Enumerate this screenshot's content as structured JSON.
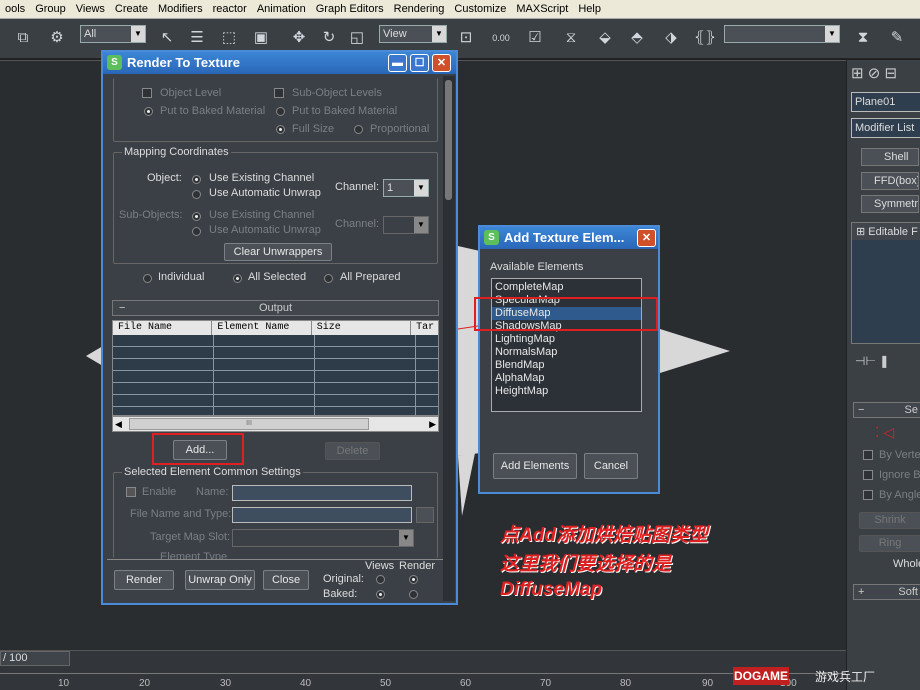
{
  "menubar": {
    "items": [
      "ools",
      "Group",
      "Views",
      "Create",
      "Modifiers",
      "reactor",
      "Animation",
      "Graph Editors",
      "Rendering",
      "Customize",
      "MAXScript",
      "Help"
    ]
  },
  "toolbar": {
    "selection_filter": "All",
    "reference_coord": "View",
    "numeric": "0.00"
  },
  "render_dialog": {
    "title": "Render To Texture",
    "object_level": "Object Level",
    "sub_object_levels": "Sub-Object Levels",
    "put_baked_material": "Put to Baked Material",
    "put_baked_material2": "Put to Baked Material",
    "full_size": "Full Size",
    "proportional": "Proportional",
    "mapping_coordinates": "Mapping Coordinates",
    "object_label": "Object:",
    "use_existing_channel": "Use Existing Channel",
    "use_automatic_unwrap": "Use Automatic Unwrap",
    "channel_label": "Channel:",
    "channel_value": "1",
    "sub_objects_label": "Sub-Objects:",
    "sub_use_existing": "Use Existing Channel",
    "sub_use_automatic": "Use Automatic Unwrap",
    "sub_channel_label": "Channel:",
    "clear_unwrappers": "Clear Unwrappers",
    "individual": "Individual",
    "all_selected": "All Selected",
    "all_prepared": "All Prepared",
    "output_header": "Output",
    "collapse": "−",
    "columns": [
      "File Name",
      "Element Name",
      "Size",
      "Tar"
    ],
    "scroll_grip": "III",
    "add_button": "Add...",
    "delete_button": "Delete",
    "selected_common": "Selected Element Common Settings",
    "enable": "Enable",
    "name_label": "Name:",
    "file_name_type": "File Name and Type:",
    "target_map_slot": "Target Map Slot:",
    "element_type": "Element Type",
    "render_button": "Render",
    "unwrap_only_button": "Unwrap Only",
    "close_button": "Close",
    "views": "Views",
    "render_col": "Render",
    "original": "Original:",
    "baked": "Baked:"
  },
  "add_dialog": {
    "title": "Add Texture Elem...",
    "available_elements": "Available Elements",
    "items": [
      "CompleteMap",
      "SpecularMap",
      "DiffuseMap",
      "ShadowsMap",
      "LightingMap",
      "NormalsMap",
      "BlendMap",
      "AlphaMap",
      "HeightMap"
    ],
    "selected_index": 2,
    "add_elements_button": "Add Elements",
    "cancel_button": "Cancel"
  },
  "annotation": {
    "line1": "点Add添加烘焙贴图类型",
    "line2": "这里我们要选择的是",
    "line3": "DiffuseMap"
  },
  "right_panel": {
    "object_name": "Plane01",
    "modifier_list": "Modifier List",
    "buttons": [
      "Shell",
      "FFD(box)",
      "Symmetry"
    ],
    "stack_item": "Editable F",
    "sel_rollout": "Se",
    "by_vertex": "By Verte",
    "ignore_back": "Ignore B",
    "by_angle": "By Angle",
    "shrink": "Shrink",
    "ring": "Ring",
    "whole": "Whole",
    "soft": "Soft"
  },
  "timeline": {
    "frame": "/ 100",
    "ticks": [
      "10",
      "20",
      "30",
      "40",
      "50",
      "60",
      "70",
      "80",
      "90",
      "100"
    ]
  },
  "watermark": {
    "brand": "DOGAME",
    "site": "游戏兵工厂"
  },
  "colors": {
    "title_blue": "#2a66b8",
    "highlight_red": "#e02020",
    "selection": "#2e5a8e"
  }
}
